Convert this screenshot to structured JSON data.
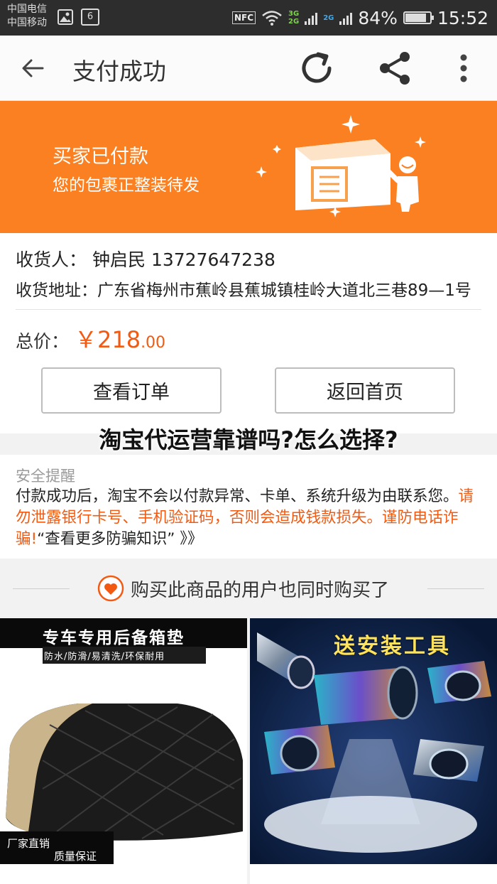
{
  "status_bar": {
    "carrier_1": "中国电信",
    "carrier_2": "中国移动",
    "notification_badge": "6",
    "nfc": "NFC",
    "net_3g": "3G",
    "net_2g": "2G",
    "net_2g_b": "2G",
    "battery": "84%",
    "battery_level": 0.84,
    "time": "15:52"
  },
  "appbar": {
    "title": "支付成功",
    "icons": [
      "back-arrow-icon",
      "refresh-icon",
      "share-icon",
      "more-vertical-icon"
    ]
  },
  "banner": {
    "title": "买家已付款",
    "subtitle": "您的包裹正整装待发",
    "background": "#fb8021"
  },
  "order": {
    "receiver_label": "收货人：",
    "receiver_name": "钟启民",
    "receiver_phone": "13727647238",
    "address_label": "收货地址：",
    "address": "广东省梅州市蕉岭县蕉城镇桂岭大道北三巷89—1号",
    "total_label": "总价：",
    "currency": "￥",
    "price_integer": "218",
    "price_decimal": ".00",
    "price_color": "#f25a12"
  },
  "buttons": {
    "view_order": "查看订单",
    "back_home": "返回首页"
  },
  "overlay_headline": "淘宝代运营靠谱吗?怎么选择?",
  "security": {
    "title": "安全提醒",
    "text_normal": "付款成功后，淘宝不会以付款异常、卡单、系统升级为由联系您。",
    "text_warning": "请勿泄露银行卡号、手机验证码，否则会造成钱款损失。谨防电话诈骗!",
    "link_text": "“查看更多防骗知识” 》》"
  },
  "also_bought": {
    "title": "购买此商品的用户也同时购买了"
  },
  "products": [
    {
      "banner_text": "专车专用后备箱垫",
      "feature_text": "防水/防滑/易清洗/环保耐用",
      "badge_1": "厂家直销",
      "badge_2": "质量保证",
      "name": "专车专用后备箱垫"
    },
    {
      "banner_text": "送安装工具",
      "name": "送安装工具"
    }
  ]
}
